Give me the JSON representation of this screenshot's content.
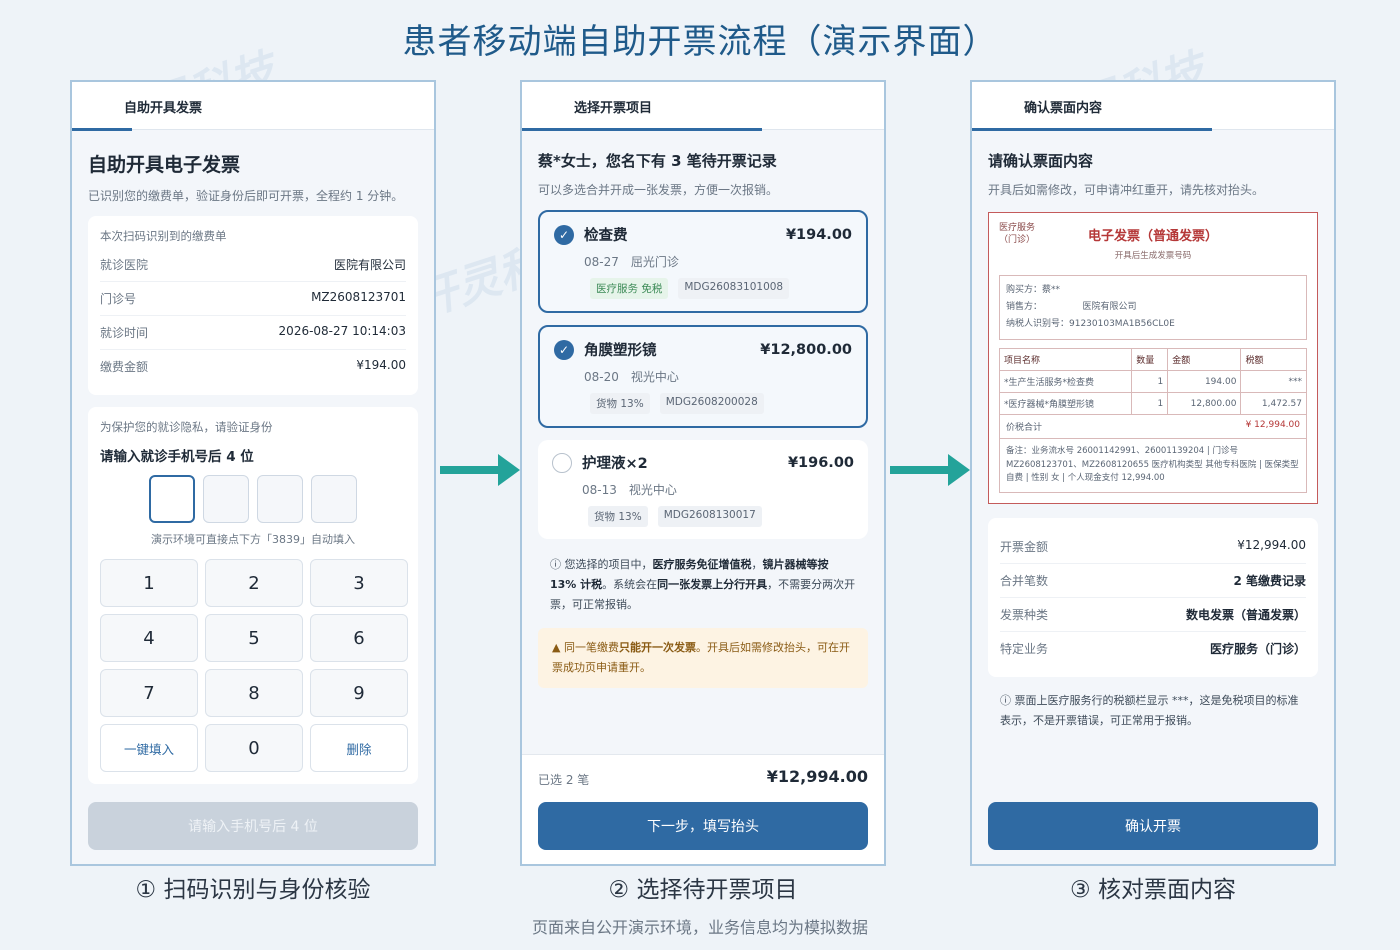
{
  "page_title": "患者移动端自助开票流程（演示界面）",
  "bottom_note": "页面来自公开演示环境，业务信息均为模拟数据",
  "watermark_text": "开灵科技",
  "colors": {
    "primary": "#2f6aa3",
    "arrow": "#23a39a",
    "invoice_red": "#b53838"
  },
  "step1": {
    "tab": "自助开具发票",
    "title": "自助开具电子发票",
    "subtitle": "已识别您的缴费单，验证身份后即可开票，全程约 1 分钟。",
    "card_title": "本次扫码识别到的缴费单",
    "fields": [
      {
        "k": "就诊医院",
        "v": "医院有限公司"
      },
      {
        "k": "门诊号",
        "v": "MZ2608123701"
      },
      {
        "k": "就诊时间",
        "v": "2026-08-27 10:14:03"
      },
      {
        "k": "缴费金额",
        "v": "¥194.00"
      }
    ],
    "verify_note": "为保护您的就诊隐私，请验证身份",
    "verify_title": "请输入就诊手机号后 4 位",
    "hint": "演示环境可直接点下方「3839」自动填入",
    "keys": [
      "1",
      "2",
      "3",
      "4",
      "5",
      "6",
      "7",
      "8",
      "9",
      "一键填入",
      "0",
      "删除"
    ],
    "button": "请输入手机号后 4 位",
    "caption": "① 扫码识别与身份核验"
  },
  "step2": {
    "tab": "选择开票项目",
    "title": "蔡*女士，您名下有 3 笔待开票记录",
    "subtitle": "可以多选合并开成一张发票，方便一次报销。",
    "items": [
      {
        "name": "检查费",
        "price": "¥194.00",
        "meta": "08-27　屈光门诊",
        "tag1": "医疗服务 免税",
        "tag2": "MDG26083101008",
        "selected": true
      },
      {
        "name": "角膜塑形镜",
        "price": "¥12,800.00",
        "meta": "08-20　视光中心",
        "tag1": "货物 13%",
        "tag2": "MDG2608200028",
        "selected": true
      },
      {
        "name": "护理液×2",
        "price": "¥196.00",
        "meta": "08-13　视光中心",
        "tag1": "货物 13%",
        "tag2": "MDG2608130017",
        "selected": false
      }
    ],
    "info_a": "您选择的项目中，",
    "info_b": "医疗服务免征增值税",
    "info_c": "，",
    "info_d": "镜片器械等按 13% 计税",
    "info_e": "。系统会在",
    "info_f": "同一张发票上分行开具",
    "info_g": "，不需要分两次开票，可正常报销。",
    "warn_a": "同一笔缴费",
    "warn_b": "只能开一次发票",
    "warn_c": "。开具后如需修改抬头，可在开票成功页申请重开。",
    "selected_count": "已选 2 笔",
    "total": "¥12,994.00",
    "button": "下一步，填写抬头",
    "caption": "② 选择待开票项目"
  },
  "step3": {
    "tab": "确认票面内容",
    "title": "请确认票面内容",
    "subtitle": "开具后如需修改，可申请冲红重开，请先核对抬头。",
    "invoice": {
      "service_tag": "医疗服务\n（门诊）",
      "title": "电子发票（普通发票）",
      "no_note": "开具后生成发票号码",
      "buyer": "购买方：蔡**",
      "seller": "销售方：　　　　　医院有限公司",
      "tax_id": "纳税人识别号：91230103MA1B56CL0E",
      "headers": [
        "项目名称",
        "数量",
        "金额",
        "税额"
      ],
      "rows": [
        [
          "*生产生活服务*检查费",
          "1",
          "194.00",
          "***"
        ],
        [
          "*医疗器械*角膜塑形镜",
          "1",
          "12,800.00",
          "1,472.57"
        ]
      ],
      "total_label": "价税合计",
      "total_value": "¥ 12,994.00",
      "note": "备注：业务流水号 26001142991、26001139204 | 门诊号 MZ2608123701、MZ2608120655 医疗机构类型 其他专科医院 | 医保类型 自费 | 性别 女 | 个人现金支付 12,994.00"
    },
    "summary": [
      {
        "k": "开票金额",
        "v": "¥12,994.00"
      },
      {
        "k": "合并笔数",
        "v": "2 笔缴费记录"
      },
      {
        "k": "发票种类",
        "v": "数电发票（普通发票）"
      },
      {
        "k": "特定业务",
        "v": "医疗服务（门诊）"
      }
    ],
    "note": "票面上医疗服务行的税额栏显示 ***，这是免税项目的标准表示，不是开票错误，可正常用于报销。",
    "button": "确认开票",
    "caption": "③ 核对票面内容"
  }
}
